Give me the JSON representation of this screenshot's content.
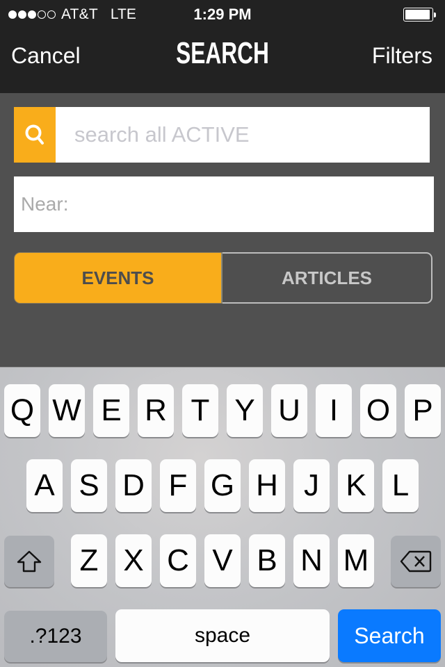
{
  "status_bar": {
    "signal_bars_filled": 3,
    "signal_bars_total": 5,
    "carrier": "AT&T",
    "network": "LTE",
    "time": "1:29 PM",
    "battery_level": 0.95
  },
  "nav": {
    "cancel_label": "Cancel",
    "title": "SEARCH",
    "filters_label": "Filters"
  },
  "search": {
    "icon": "search-icon",
    "value": "",
    "placeholder": "search all ACTIVE"
  },
  "near": {
    "value": "",
    "placeholder": "Near:"
  },
  "segments": {
    "selected": "events",
    "items": [
      {
        "id": "events",
        "label": "EVENTS"
      },
      {
        "id": "articles",
        "label": "ARTICLES"
      }
    ]
  },
  "keyboard": {
    "rows": [
      [
        "Q",
        "W",
        "E",
        "R",
        "T",
        "Y",
        "U",
        "I",
        "O",
        "P"
      ],
      [
        "A",
        "S",
        "D",
        "F",
        "G",
        "H",
        "J",
        "K",
        "L"
      ],
      [
        "Z",
        "X",
        "C",
        "V",
        "B",
        "N",
        "M"
      ]
    ],
    "shift_icon": "shift-icon",
    "delete_icon": "delete-icon",
    "numbers_label": ".?123",
    "space_label": "space",
    "return_label": "Search"
  },
  "colors": {
    "accent": "#f9ad1b",
    "nav_bg": "#222222",
    "content_bg": "#505050",
    "return_key": "#0a7aff"
  }
}
